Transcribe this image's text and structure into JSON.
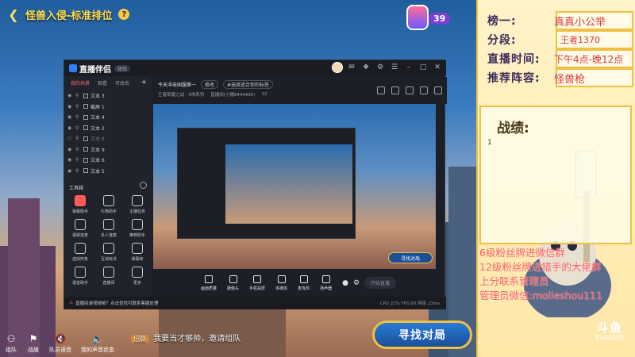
{
  "game": {
    "title": "怪兽入侵-标准排位",
    "level": "39",
    "find_match": "寻找对局",
    "chat_tag": "招募",
    "chat_text": "我要当才够帅，邀请组队",
    "bottom_items": [
      {
        "icon": "team-icon",
        "label": "组队"
      },
      {
        "icon": "flag-icon",
        "label": "战旗"
      },
      {
        "icon": "voice-off-icon",
        "label": "队员语音"
      },
      {
        "icon": "mute-icon",
        "label": "我的声音状态"
      }
    ]
  },
  "app": {
    "name": "直播伴侣",
    "badge": "体验",
    "scene_tabs": [
      "我的场景",
      "观看",
      "可改名"
    ],
    "scene_items": [
      {
        "label": "文本 3",
        "dim": false
      },
      {
        "label": "截屏 1",
        "dim": false
      },
      {
        "label": "文本 4",
        "dim": false
      },
      {
        "label": "文本 2",
        "dim": false
      },
      {
        "label": "文本 8",
        "dim": true
      },
      {
        "label": "文本 9",
        "dim": false
      },
      {
        "label": "文本 6",
        "dim": false
      },
      {
        "label": "文本 5",
        "dim": false
      }
    ],
    "tools_heading": "工具箱",
    "tools": [
      {
        "label": "弹幕助手",
        "active": true
      },
      {
        "label": "礼物助手",
        "active": false
      },
      {
        "label": "主播任务",
        "active": false
      },
      {
        "label": "视频连麦",
        "active": false
      },
      {
        "label": "多人连麦",
        "active": false
      },
      {
        "label": "推荐助手",
        "active": false
      },
      {
        "label": "虚拟形象",
        "active": false
      },
      {
        "label": "互动玩法",
        "active": false
      },
      {
        "label": "弹幕库",
        "active": false
      },
      {
        "label": "语音助手",
        "active": false
      },
      {
        "label": "直播间",
        "active": false
      },
      {
        "label": "更多",
        "active": false
      }
    ],
    "room_title": "今天冲击国服第一",
    "edit_label": "修改",
    "topic_label": "#选择适合你的标签",
    "category": "王者荣耀之战 · 5排系列",
    "room_meta": "直播间(小播8444990)",
    "viewers": "12",
    "bottom_tools": [
      "画面质量",
      "摄像头",
      "手机投屏",
      "多媒体",
      "麦克风",
      "扬声器"
    ],
    "start_live": "开始直播",
    "status_warn": "直播间游戏掉帧？点击查找可联系客服处理",
    "status_stats": "CPU 22%  FPS 60  网络 23ms"
  },
  "overlay": {
    "rank_label": "榜一:",
    "rank_value": "真真小公举",
    "tier_label": "分段:",
    "tier_value": "王者1370",
    "time_label": "直播时间:",
    "time_value": "下午4点-晚12点",
    "lineup_label": "推荐阵容:",
    "lineup_value": "怪兽枪",
    "record_title": "战绩:",
    "record_value": "1",
    "ad_lines": [
      "6级粉丝牌进微信群",
      "12级粉丝牌进猎手的大佬群",
      "上分联系管理员",
      "管理员微信:molieshou111"
    ],
    "watermark": "斗鱼",
    "room_id": "8444990"
  }
}
